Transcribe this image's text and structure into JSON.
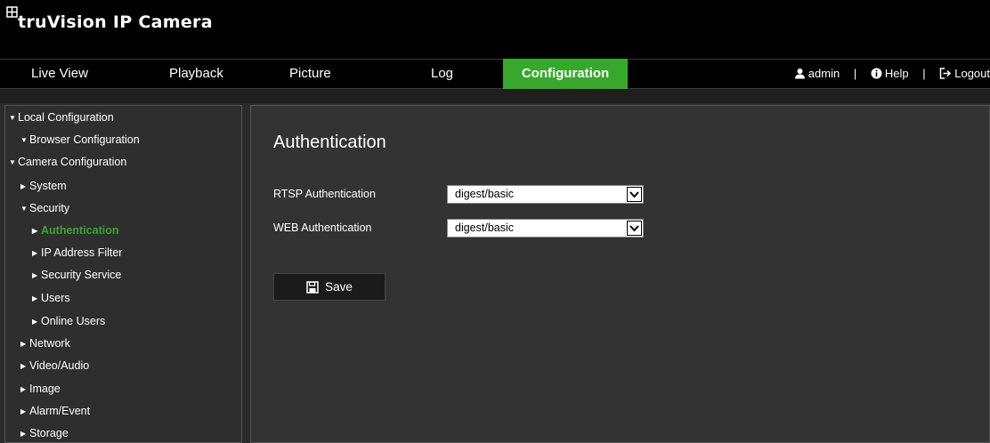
{
  "header": {
    "logo_text": "truVision  IP Camera"
  },
  "nav": {
    "tabs": [
      {
        "label": "Live View"
      },
      {
        "label": "Playback"
      },
      {
        "label": "Picture"
      },
      {
        "label": "Log"
      },
      {
        "label": "Configuration",
        "active": true
      }
    ],
    "user": {
      "username": "admin",
      "help": "Help",
      "logout": "Logout"
    },
    "separator": "|"
  },
  "sidebar": {
    "items": [
      {
        "label": "Local Configuration",
        "expanded": true
      },
      {
        "label": "Browser Configuration",
        "expanded": true
      },
      {
        "label": "Camera Configuration",
        "expanded": true
      },
      {
        "label": "System",
        "expanded": false
      },
      {
        "label": "Security",
        "expanded": true
      },
      {
        "label": "Authentication",
        "selected": true
      },
      {
        "label": "IP Address Filter"
      },
      {
        "label": "Security Service"
      },
      {
        "label": "Users"
      },
      {
        "label": "Online Users"
      },
      {
        "label": "Network"
      },
      {
        "label": "Video/Audio"
      },
      {
        "label": "Image"
      },
      {
        "label": "Alarm/Event"
      },
      {
        "label": "Storage"
      }
    ]
  },
  "main": {
    "title": "Authentication",
    "fields": [
      {
        "label": "RTSP Authentication",
        "value": "digest/basic"
      },
      {
        "label": "WEB Authentication",
        "value": "digest/basic"
      }
    ],
    "save_label": "Save"
  },
  "colors": {
    "accent": "#36a82b",
    "background": "#2b2b2b",
    "header": "#000000"
  }
}
